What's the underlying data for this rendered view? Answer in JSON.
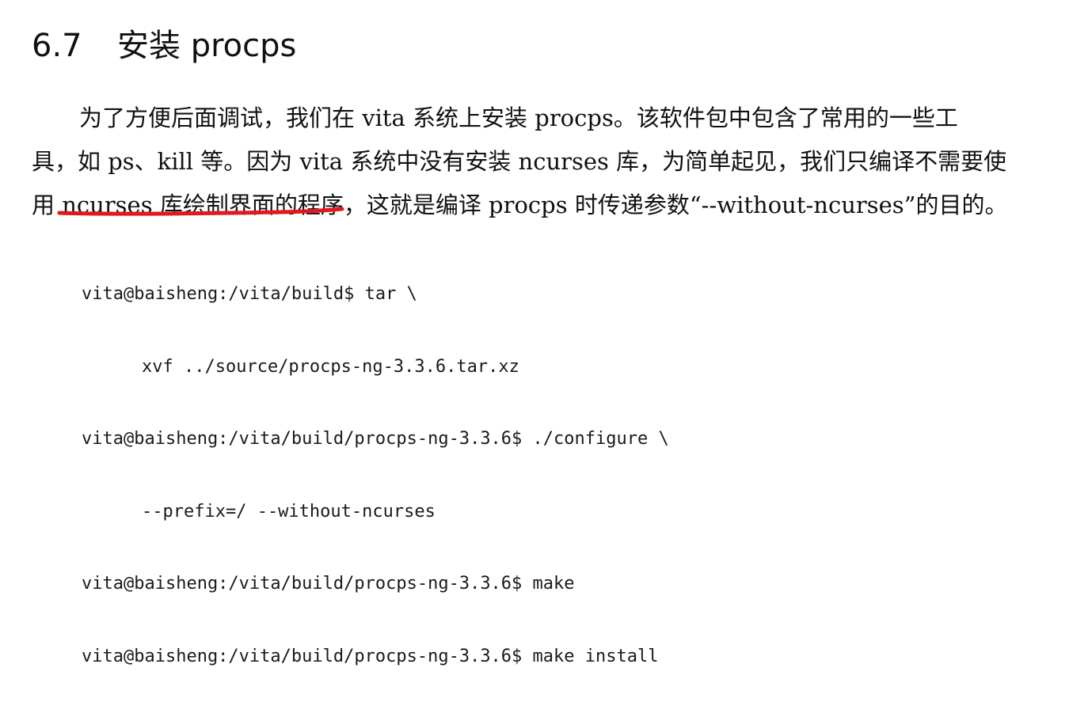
{
  "section": {
    "number": "6.7",
    "title": "安装 procps"
  },
  "paragraph": {
    "line1": "为了方便后面调试，我们在 vita 系统上安装 procps。该软件包中包含了常用的一些工",
    "line2": "具，如 ps、kill 等。因为 vita 系统中没有安装 ncurses 库，为简单起见，我们只编译不需要使",
    "line3_prefix": "用 ",
    "line3_underlined": "ncurses 库绘制界面的程序",
    "line3_suffix": "，这就是编译 procps 时传递参数“--without-ncurses”的目的。"
  },
  "annotation": {
    "underline_color": "#e0191e"
  },
  "code": {
    "line1": "vita@baisheng:/vita/build$ tar \\",
    "line2": "xvf ../source/procps-ng-3.3.6.tar.xz",
    "line3": "vita@baisheng:/vita/build/procps-ng-3.3.6$ ./configure \\",
    "line4": "--prefix=/ --without-ncurses",
    "line5": "vita@baisheng:/vita/build/procps-ng-3.3.6$ make",
    "line6": "vita@baisheng:/vita/build/procps-ng-3.3.6$ make install"
  }
}
